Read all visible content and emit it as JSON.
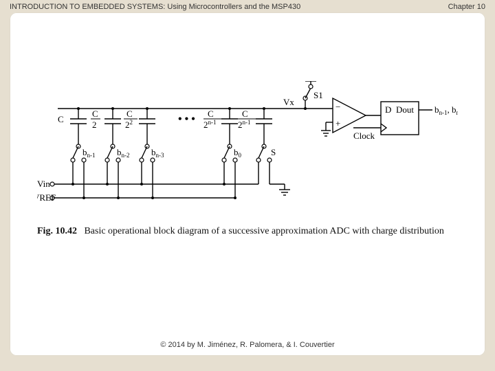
{
  "header": {
    "title": "INTRODUCTION TO EMBEDDED SYSTEMS: Using Microcontrollers and the MSP430",
    "chapter": "Chapter 10"
  },
  "figure": {
    "number": "Fig. 10.42",
    "caption_rest": "Basic operational block diagram of a successive approximation ADC with charge distribution",
    "labels": {
      "Vin": "Vin",
      "VREF": "VREF",
      "Vx": "Vx",
      "S1": "S1",
      "S": "S",
      "Clock": "Clock",
      "D": "D",
      "Dout": "Dout",
      "outbits": "b",
      "outbits_rest": ", b",
      "outbits_tail": ", …",
      "cap": {
        "c1": "C",
        "c2_num": "C",
        "c2_den": "2",
        "c3_num": "C",
        "c3_den": "2",
        "c3_exp": "2",
        "c4_num": "C",
        "c4_den": "2",
        "c4_exp": "n-1",
        "c5_num": "C",
        "c5_den": "2",
        "c5_exp": "n-1"
      },
      "switch_b": {
        "b1": "b",
        "b1_sub": "n-1",
        "b2": "b",
        "b2_sub": "n-2",
        "b3": "b",
        "b3_sub": "n-3",
        "b4": "b",
        "b4_sub": "0"
      },
      "ellipsis": "• • •"
    }
  },
  "footer": {
    "copyright": "© 2014 by M. Jiménez, R. Palomera, & I. Couvertier"
  }
}
